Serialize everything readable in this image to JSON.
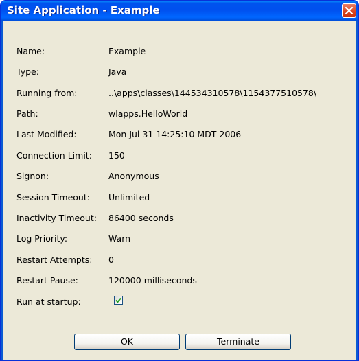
{
  "window": {
    "title": "Site Application - Example"
  },
  "fields": [
    {
      "label": "Name:",
      "value": "Example"
    },
    {
      "label": "Type:",
      "value": "Java"
    },
    {
      "label": "Running from:",
      "value": "..\\apps\\classes\\144534310578\\1154377510578\\"
    },
    {
      "label": "Path:",
      "value": "wlapps.HelloWorld"
    },
    {
      "label": "Last Modified:",
      "value": "Mon Jul 31 14:25:10 MDT 2006"
    },
    {
      "label": "Connection Limit:",
      "value": "150"
    },
    {
      "label": "Signon:",
      "value": "Anonymous"
    },
    {
      "label": "Session Timeout:",
      "value": "Unlimited"
    },
    {
      "label": "Inactivity Timeout:",
      "value": "86400 seconds"
    },
    {
      "label": "Log Priority:",
      "value": "Warn"
    },
    {
      "label": "Restart Attempts:",
      "value": "0"
    },
    {
      "label": "Restart Pause:",
      "value": "120000 milliseconds"
    }
  ],
  "run_at_startup": {
    "label": "Run at startup:",
    "checked": true
  },
  "buttons": {
    "ok": "OK",
    "terminate": "Terminate"
  }
}
